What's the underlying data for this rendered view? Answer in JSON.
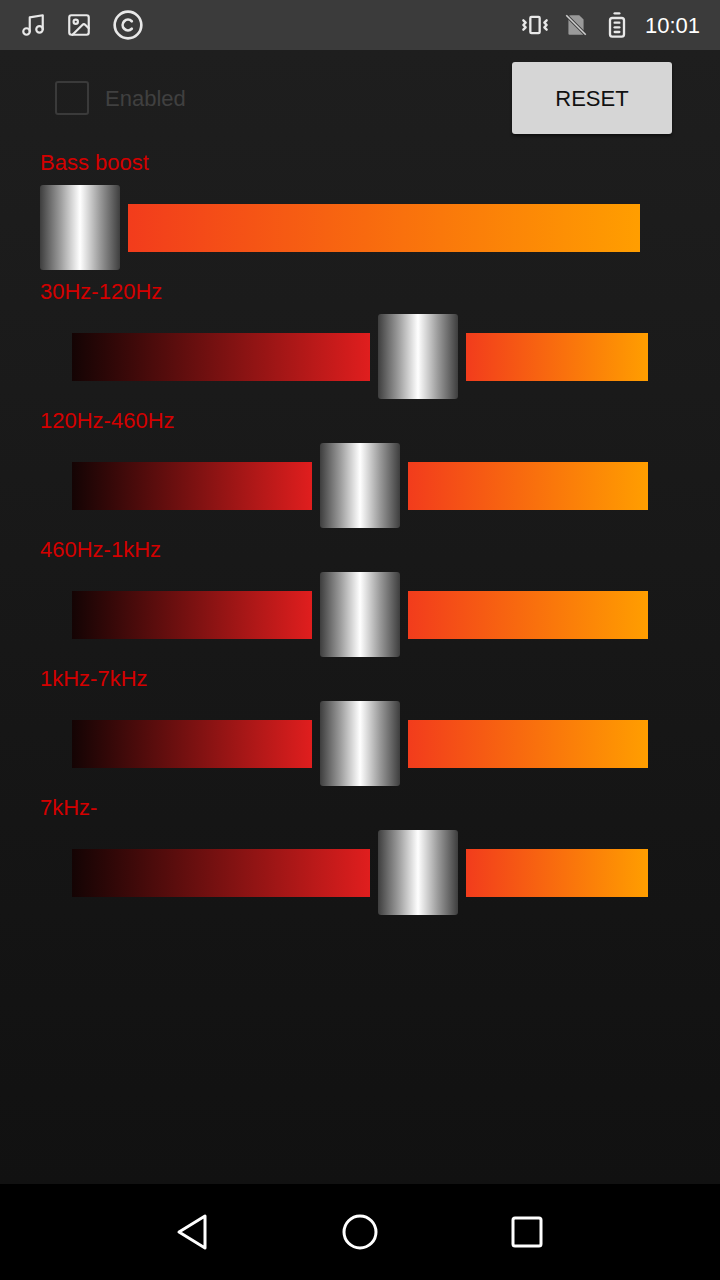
{
  "status_bar": {
    "time": "10:01"
  },
  "enabled": {
    "label": "Enabled",
    "checked": false
  },
  "buttons": [
    "RESET"
  ],
  "sliders": [
    {
      "label": "Bass boost",
      "level": 0,
      "kind": "boost"
    },
    {
      "label": "30Hz-120Hz",
      "level": 0.62,
      "kind": "band"
    },
    {
      "label": "120Hz-460Hz",
      "level": 0.5,
      "kind": "band"
    },
    {
      "label": "460Hz-1kHz",
      "level": 0.5,
      "kind": "band"
    },
    {
      "label": "1kHz-7kHz",
      "level": 0.5,
      "kind": "band"
    },
    {
      "label": "7kHz-",
      "level": 0.62,
      "kind": "band"
    }
  ]
}
